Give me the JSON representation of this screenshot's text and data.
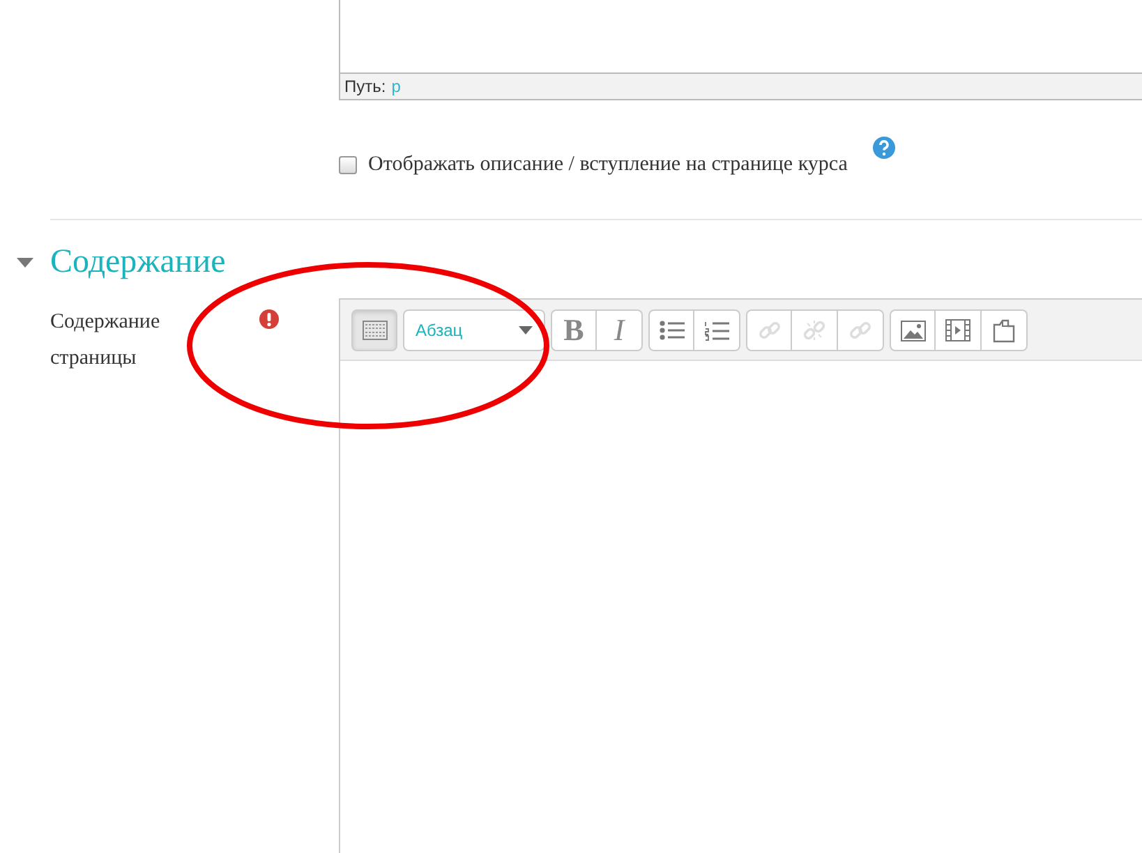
{
  "top_editor": {
    "path_label": "Путь:",
    "path_value": "p"
  },
  "show_description": {
    "label": "Отображать описание / вступление на странице курса",
    "checked": false
  },
  "section": {
    "title": "Содержание",
    "expanded": true
  },
  "content_field": {
    "label": "Содержание страницы",
    "required": true,
    "toolbar": [
      {
        "buttons": [
          {
            "kind": "toggle",
            "on": true
          }
        ]
      },
      {
        "buttons": [
          {
            "kind": "select",
            "text": "Абзац"
          }
        ]
      },
      {
        "buttons": [
          {
            "kind": "bold",
            "text": "B",
            "disabled": false
          },
          {
            "kind": "italic",
            "text": "I",
            "disabled": false
          }
        ]
      },
      {
        "buttons": [
          {
            "kind": "bullets",
            "disabled": false
          },
          {
            "kind": "numbers",
            "disabled": false
          }
        ]
      },
      {
        "buttons": [
          {
            "kind": "link",
            "disabled": true
          },
          {
            "kind": "unlink",
            "disabled": true
          },
          {
            "kind": "link",
            "disabled": true
          }
        ]
      },
      {
        "buttons": [
          {
            "kind": "image",
            "disabled": false
          },
          {
            "kind": "media",
            "disabled": false
          },
          {
            "kind": "files",
            "disabled": false
          }
        ]
      }
    ]
  },
  "annotation": {
    "kind": "ellipse",
    "color": "#ee0000"
  }
}
